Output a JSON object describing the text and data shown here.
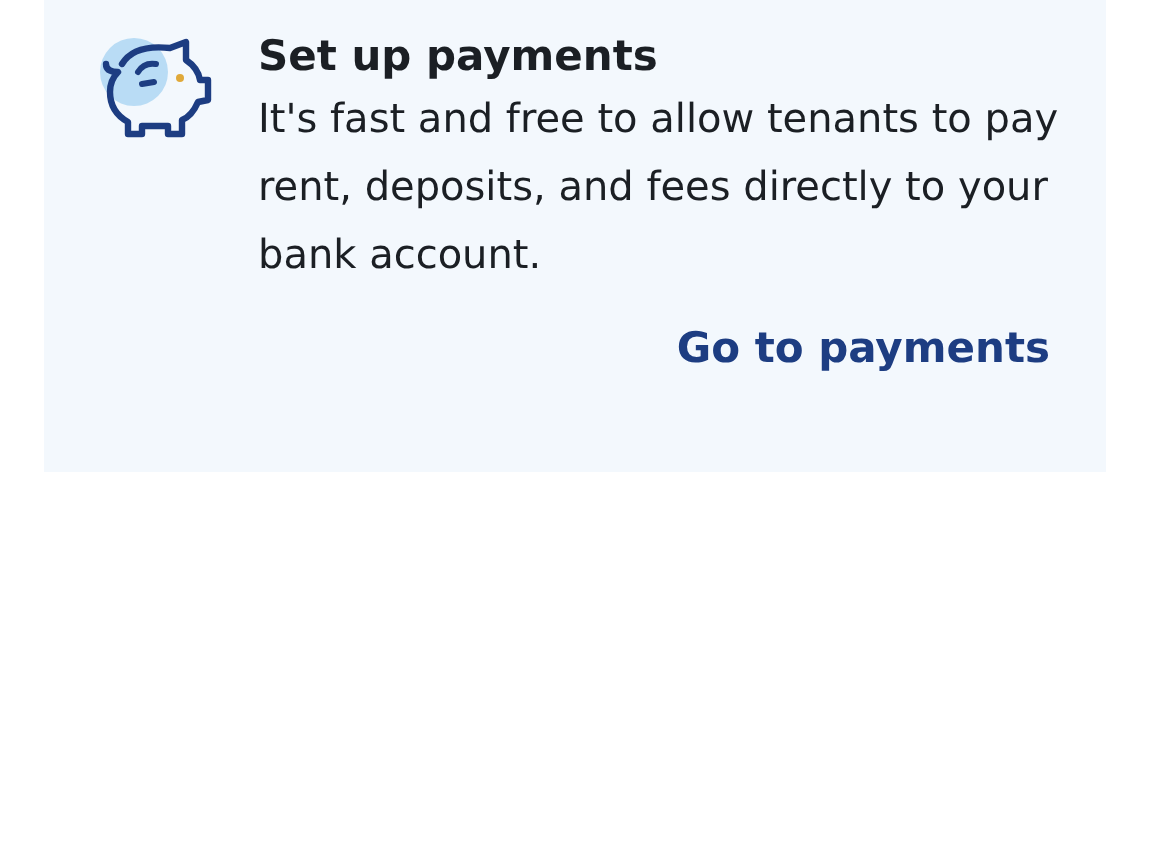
{
  "card": {
    "title": "Set up payments",
    "description": "It's fast and free to allow tenants to pay rent, deposits, and fees directly to your bank account.",
    "link": "Go to payments"
  }
}
